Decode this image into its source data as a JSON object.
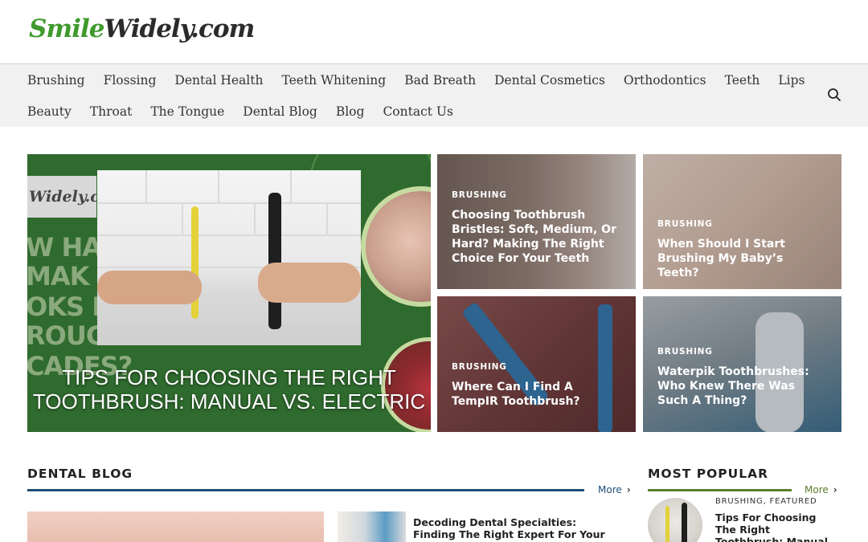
{
  "site": {
    "logo_part1": "Smile",
    "logo_part2": "Widely.com"
  },
  "nav": {
    "row1": [
      "Brushing",
      "Flossing",
      "Dental Health",
      "Teeth Whitening",
      "Bad Breath",
      "Dental Cosmetics",
      "Orthodontics",
      "Teeth",
      "Lips"
    ],
    "row2": [
      "Beauty",
      "Throat",
      "The Tongue",
      "Dental Blog",
      "Blog",
      "Contact Us"
    ],
    "search_icon": "search-icon"
  },
  "hero": {
    "image_badge": "Widely.com",
    "image_bg_text": [
      "W HA",
      "MAK",
      "OKS E",
      "ROUG",
      "CADES?"
    ],
    "title_line1": "TIPS FOR CHOOSING THE RIGHT",
    "title_line2": "TOOTHBRUSH: MANUAL VS. ELECTRIC"
  },
  "cards": [
    {
      "category": "BRUSHING",
      "title": "Choosing Toothbrush Bristles: Soft, Medium, Or Hard? Making The Right Choice For Your Teeth"
    },
    {
      "category": "BRUSHING",
      "title": "When Should I Start Brushing My Baby’s Teeth?"
    },
    {
      "category": "BRUSHING",
      "title": "Where Can I Find A TempIR Toothbrush?"
    },
    {
      "category": "BRUSHING",
      "title": "Waterpik Toothbrushes: Who Knew There Was Such A Thing?"
    }
  ],
  "dental_blog": {
    "heading": "DENTAL BLOG",
    "more_label": "More",
    "chevron_icon": "chevron-right-icon",
    "accent_color": "#1f4e79",
    "post_title": "Decoding Dental Specialties: Finding The Right Expert For Your Needs"
  },
  "most_popular": {
    "heading": "MOST POPULAR",
    "more_label": "More",
    "accent_color": "#5a7d2b",
    "post_category": "BRUSHING, FEATURED",
    "post_title": "Tips For Choosing The Right Toothbrush: Manual Vs. Electric"
  },
  "colors": {
    "brand_green": "#3f9a2d",
    "nav_background": "#f1f1f1"
  }
}
